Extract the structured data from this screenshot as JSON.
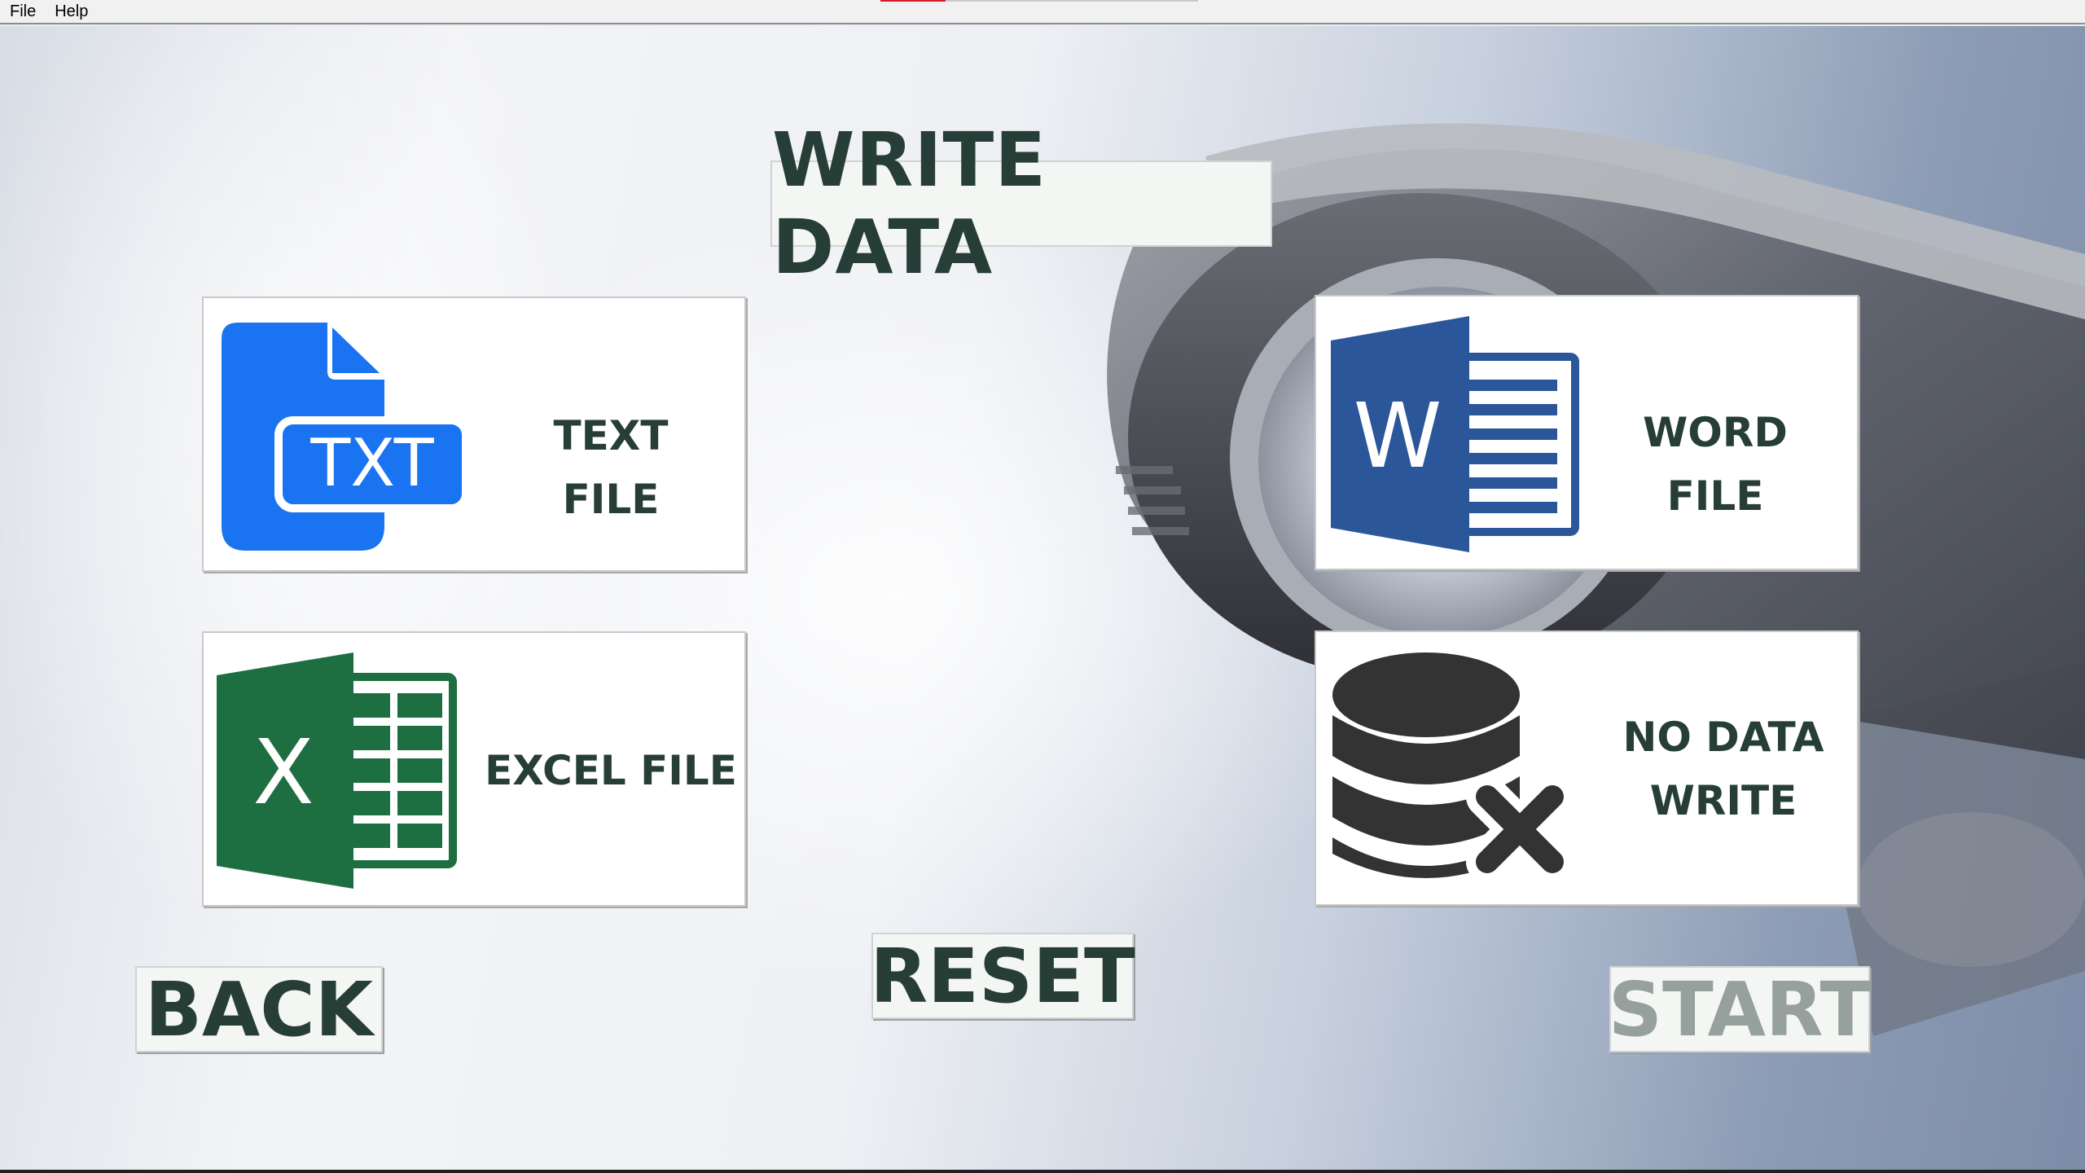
{
  "menu": {
    "items": [
      "File",
      "Help"
    ]
  },
  "heading": "WRITE DATA",
  "options": {
    "text_file": {
      "label": "TEXT FILE",
      "icon": "txt-file-icon",
      "icon_text": "TXT",
      "color": "#1a73f0"
    },
    "word_file": {
      "label": "WORD FILE",
      "icon": "word-icon",
      "icon_text": "W",
      "color": "#2b579a"
    },
    "excel_file": {
      "label": "EXCEL FILE",
      "icon": "excel-icon",
      "icon_text": "X",
      "color": "#1d6f42"
    },
    "no_data": {
      "label_line1": "NO DATA",
      "label_line2": "WRITE",
      "icon": "database-x-icon",
      "color": "#333333"
    }
  },
  "buttons": {
    "back": "BACK",
    "reset": "RESET",
    "start": "START"
  },
  "colors": {
    "label_text": "#273e37",
    "disabled_text": "#96a09c",
    "accent": "#d41c2a"
  }
}
